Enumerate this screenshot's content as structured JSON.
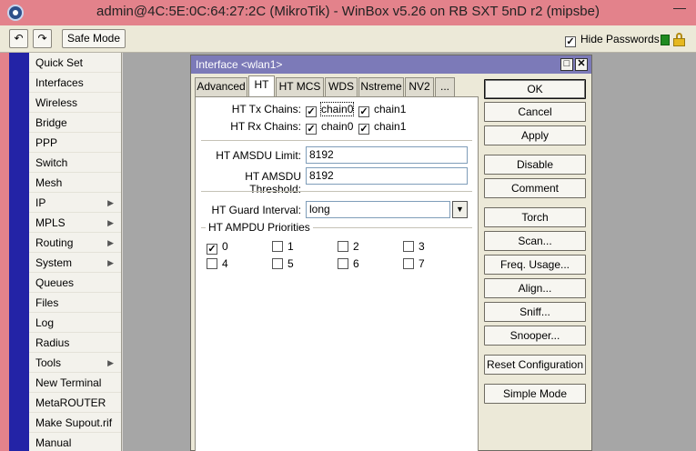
{
  "window": {
    "title": "admin@4C:5E:0C:64:27:2C (MikroTik) - WinBox v5.26 on RB SXT 5nD r2 (mipsbe)",
    "minimize_glyph": "—"
  },
  "toolbar": {
    "undo_icon": "↶",
    "redo_icon": "↷",
    "safe_mode_label": "Safe Mode",
    "hide_passwords_label": "Hide Passwords",
    "hide_passwords_checked": "✓"
  },
  "sidemenu": {
    "items": [
      {
        "label": "Quick Set",
        "arrow": ""
      },
      {
        "label": "Interfaces",
        "arrow": ""
      },
      {
        "label": "Wireless",
        "arrow": ""
      },
      {
        "label": "Bridge",
        "arrow": ""
      },
      {
        "label": "PPP",
        "arrow": ""
      },
      {
        "label": "Switch",
        "arrow": ""
      },
      {
        "label": "Mesh",
        "arrow": ""
      },
      {
        "label": "IP",
        "arrow": "▶"
      },
      {
        "label": "MPLS",
        "arrow": "▶"
      },
      {
        "label": "Routing",
        "arrow": "▶"
      },
      {
        "label": "System",
        "arrow": "▶"
      },
      {
        "label": "Queues",
        "arrow": ""
      },
      {
        "label": "Files",
        "arrow": ""
      },
      {
        "label": "Log",
        "arrow": ""
      },
      {
        "label": "Radius",
        "arrow": ""
      },
      {
        "label": "Tools",
        "arrow": "▶"
      },
      {
        "label": "New Terminal",
        "arrow": ""
      },
      {
        "label": "MetaROUTER",
        "arrow": ""
      },
      {
        "label": "Make Supout.rif",
        "arrow": ""
      },
      {
        "label": "Manual",
        "arrow": ""
      }
    ]
  },
  "dialog": {
    "title": "Interface <wlan1>",
    "max_glyph": "□",
    "close_glyph": "✕",
    "tabs": [
      "Advanced",
      "HT",
      "HT MCS",
      "WDS",
      "Nstreme",
      "NV2",
      "..."
    ],
    "active_tab": "HT",
    "ht": {
      "tx_chains_label": "HT Tx Chains:",
      "rx_chains_label": "HT Rx Chains:",
      "chain0": "chain0",
      "chain1": "chain1",
      "check": "✓",
      "amsdu_limit_label": "HT AMSDU Limit:",
      "amsdu_limit_value": "8192",
      "amsdu_threshold_label": "HT AMSDU Threshold:",
      "amsdu_threshold_value": "8192",
      "guard_interval_label": "HT Guard Interval:",
      "guard_interval_value": "long",
      "dropdown_glyph": "▼",
      "ampdu_title": "HT AMPDU Priorities",
      "priorities": [
        "0",
        "1",
        "2",
        "3",
        "4",
        "5",
        "6",
        "7"
      ],
      "priority_checked": [
        "✓",
        "",
        "",
        "",
        "",
        "",
        "",
        ""
      ]
    },
    "buttons": [
      "OK",
      "Cancel",
      "Apply",
      "Disable",
      "Comment",
      "Torch",
      "Scan...",
      "Freq. Usage...",
      "Align...",
      "Sniff...",
      "Snooper...",
      "Reset Configuration",
      "Simple Mode"
    ]
  }
}
